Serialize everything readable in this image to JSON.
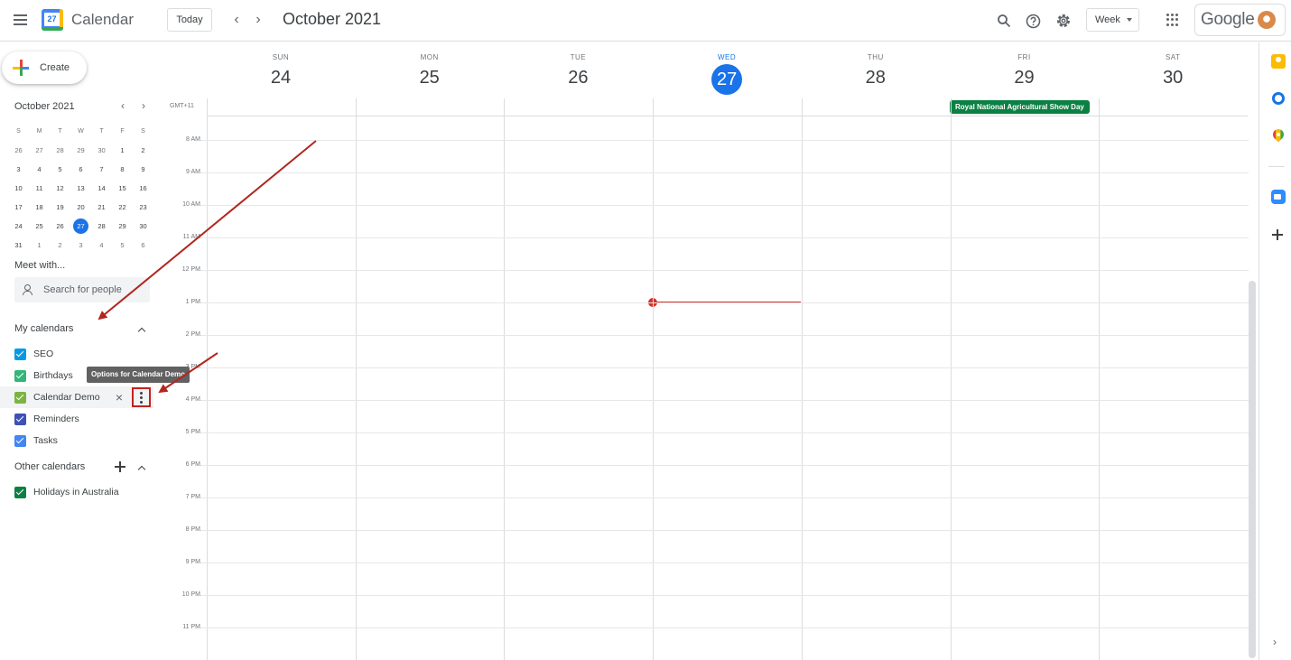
{
  "header": {
    "app_title": "Calendar",
    "logo_day": "27",
    "today_label": "Today",
    "prev_label": "‹",
    "next_label": "›",
    "period_title": "October 2021",
    "view_select": "Week",
    "account_label": "Google"
  },
  "sidebar": {
    "create_label": "Create",
    "mini_calendar": {
      "title": "October 2021",
      "days_of_week": [
        "S",
        "M",
        "T",
        "W",
        "T",
        "F",
        "S"
      ],
      "weeks": [
        [
          "26",
          "27",
          "28",
          "29",
          "30",
          "1",
          "2"
        ],
        [
          "3",
          "4",
          "5",
          "6",
          "7",
          "8",
          "9"
        ],
        [
          "10",
          "11",
          "12",
          "13",
          "14",
          "15",
          "16"
        ],
        [
          "17",
          "18",
          "19",
          "20",
          "21",
          "22",
          "23"
        ],
        [
          "24",
          "25",
          "26",
          "27",
          "28",
          "29",
          "30"
        ],
        [
          "31",
          "1",
          "2",
          "3",
          "4",
          "5",
          "6"
        ]
      ],
      "today": "27"
    },
    "meet_with_title": "Meet with...",
    "search_people_placeholder": "Search for people",
    "my_calendars_title": "My calendars",
    "my_calendars": [
      {
        "label": "SEO",
        "color": "#039be5",
        "checked": true
      },
      {
        "label": "Birthdays",
        "color": "#33b679",
        "checked": true
      },
      {
        "label": "Calendar Demo",
        "color": "#7cb342",
        "checked": true
      },
      {
        "label": "Reminders",
        "color": "#3f51b5",
        "checked": true
      },
      {
        "label": "Tasks",
        "color": "#4285f4",
        "checked": true
      }
    ],
    "options_tooltip": "Options for Calendar Demo",
    "other_calendars_title": "Other calendars",
    "other_calendars": [
      {
        "label": "Holidays in Australia",
        "color": "#0b8043",
        "checked": true
      }
    ]
  },
  "week": {
    "timezone": "GMT+11",
    "days": [
      {
        "dow": "SUN",
        "date": "24",
        "today": false
      },
      {
        "dow": "MON",
        "date": "25",
        "today": false
      },
      {
        "dow": "TUE",
        "date": "26",
        "today": false
      },
      {
        "dow": "WED",
        "date": "27",
        "today": true
      },
      {
        "dow": "THU",
        "date": "28",
        "today": false
      },
      {
        "dow": "FRI",
        "date": "29",
        "today": false
      },
      {
        "dow": "SAT",
        "date": "30",
        "today": false
      }
    ],
    "hours": [
      "8 AM",
      "9 AM",
      "10 AM",
      "11 AM",
      "12 PM",
      "1 PM",
      "2 PM",
      "3 PM",
      "4 PM",
      "5 PM",
      "6 PM",
      "7 PM",
      "8 PM",
      "9 PM",
      "10 PM",
      "11 PM"
    ],
    "all_day_events": [
      {
        "day": "FRI",
        "title": "Royal National Agricultural Show Day",
        "color": "#0b8043"
      }
    ],
    "current_time_marker": {
      "day": "WED",
      "time": "1 PM"
    }
  },
  "colors": {
    "accent": "#1a73e8",
    "now_line": "#d93025",
    "annotation": "#b3261e"
  }
}
